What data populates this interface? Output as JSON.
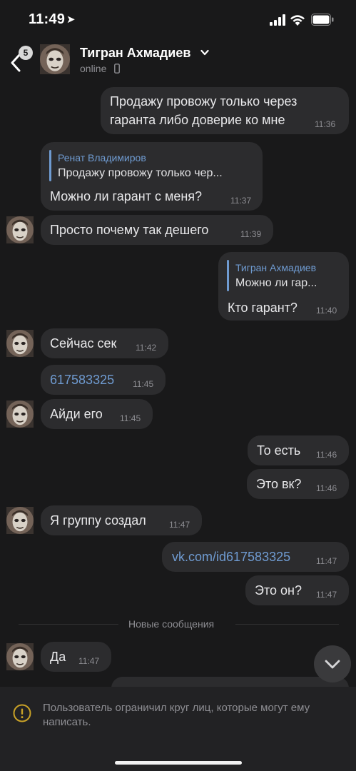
{
  "status_bar": {
    "time": "11:49",
    "location_glyph": "➤"
  },
  "header": {
    "back_badge": "5",
    "contact_name": "Тигран Ахмадиев",
    "status": "online"
  },
  "messages": [
    {
      "id": "m1",
      "direction": "out",
      "text_line1": "Продажу провожу только через",
      "text_line2": "гаранта либо доверие ко мне",
      "time": "11:36"
    },
    {
      "id": "m2",
      "direction": "in",
      "reply_author": "Ренат Владимиров",
      "reply_text": "Продажу провожу только чер...",
      "text": "Можно ли гарант с меня?",
      "time": "11:37"
    },
    {
      "id": "m3",
      "direction": "in",
      "text": "Просто почему так дешего",
      "time": "11:39"
    },
    {
      "id": "m4",
      "direction": "out",
      "reply_author": "Тигран Ахмадиев",
      "reply_text": "Можно ли гар...",
      "text": "Кто гарант?",
      "time": "11:40"
    },
    {
      "id": "m5",
      "direction": "in",
      "text": "Сейчас сек",
      "time": "11:42"
    },
    {
      "id": "m6",
      "direction": "in",
      "text": "617583325",
      "time": "11:45"
    },
    {
      "id": "m7",
      "direction": "in",
      "text": "Айди его",
      "time": "11:45"
    },
    {
      "id": "m8",
      "direction": "out",
      "text": "То есть",
      "time": "11:46"
    },
    {
      "id": "m9",
      "direction": "out",
      "text": "Это вк?",
      "time": "11:46"
    },
    {
      "id": "m10",
      "direction": "in",
      "text": "Я группу создал",
      "time": "11:47"
    },
    {
      "id": "m11",
      "direction": "out",
      "text": "vk.com/id617583325",
      "time": "11:47"
    },
    {
      "id": "m12",
      "direction": "out",
      "text": "Это он?",
      "time": "11:47"
    },
    {
      "id": "m13",
      "direction": "in",
      "text": "Да",
      "time": "11:47"
    }
  ],
  "new_messages_divider": "Новые сообщения",
  "footer": {
    "notice": "Пользователь ограничил круг лиц, которые могут ему написать."
  },
  "colors": {
    "background": "#19191a",
    "bubble": "#2c2c2e",
    "link": "#6f9bd1",
    "footer_warning_icon": "#c9a227"
  },
  "icons": [
    "back-chevron-icon",
    "chevron-down-icon",
    "phone-icon",
    "chevron-down-scroll-icon",
    "warning-icon"
  ]
}
